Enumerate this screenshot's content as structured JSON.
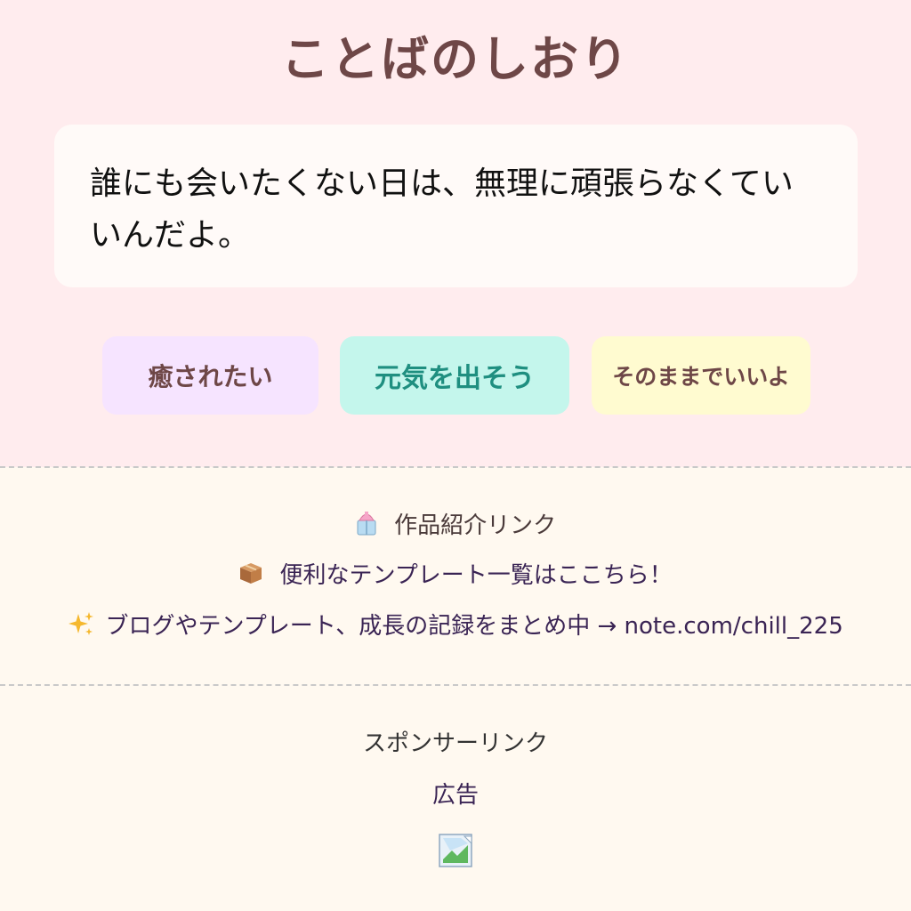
{
  "app": {
    "title": "ことばのしおり"
  },
  "quote": {
    "text": "誰にも会いたくない日は、無理に頑張らなくていいんだよ。"
  },
  "moods": [
    {
      "label": "癒されたい"
    },
    {
      "label": "元気を出そう"
    },
    {
      "label": "そのままでいいよ"
    }
  ],
  "links": {
    "portfolio": {
      "icon": "gift-icon",
      "label": "作品紹介リンク"
    },
    "templates": {
      "icon": "box-icon",
      "label": "便利なテンプレート一覧はここちら！"
    },
    "note": {
      "icon": "sparkles-icon",
      "label": "ブログやテンプレート、成長の記録をまとめ中 →",
      "url": "note.com/chill_225"
    }
  },
  "sponsor": {
    "label": "スポンサーリンク",
    "ad_label": "広告",
    "image_icon": "broken-image-icon"
  },
  "colors": {
    "top_background": "#ffecee",
    "bottom_background": "#fff9f0",
    "title": "#6e4747",
    "heal_button": "#f6e4ff",
    "genki_button": "#c4f6ec",
    "sonomama_button": "#fffbd0"
  }
}
